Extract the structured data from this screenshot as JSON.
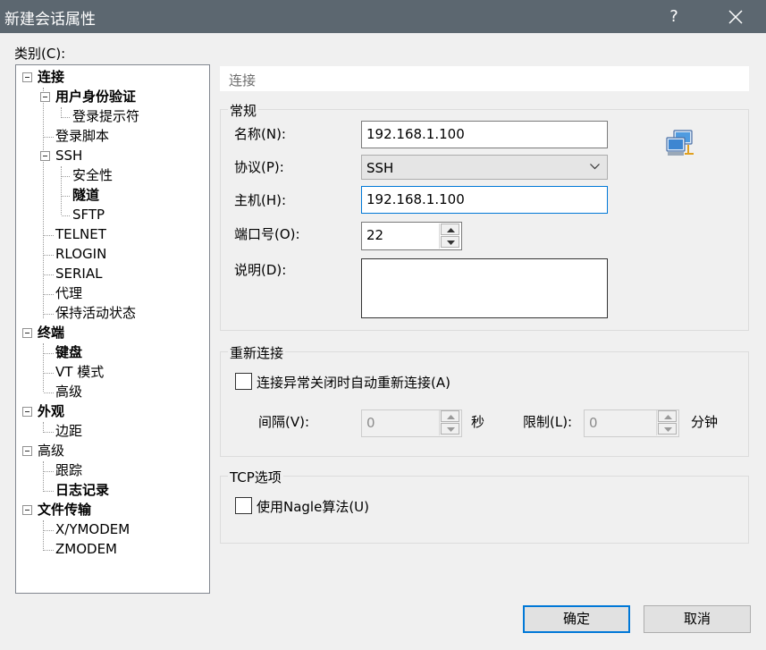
{
  "window": {
    "title": "新建会话属性",
    "help": "?"
  },
  "category_label": "类别(C):",
  "tree": [
    {
      "label": "连接",
      "bold": true,
      "expander": true
    },
    {
      "label": "用户身份验证",
      "bold": true,
      "expander": true
    },
    {
      "label": "登录提示符",
      "bold": false
    },
    {
      "label": "登录脚本",
      "bold": false
    },
    {
      "label": "SSH",
      "bold": false,
      "expander": true
    },
    {
      "label": "安全性",
      "bold": false
    },
    {
      "label": "隧道",
      "bold": true
    },
    {
      "label": "SFTP",
      "bold": false
    },
    {
      "label": "TELNET",
      "bold": false
    },
    {
      "label": "RLOGIN",
      "bold": false
    },
    {
      "label": "SERIAL",
      "bold": false
    },
    {
      "label": "代理",
      "bold": false
    },
    {
      "label": "保持活动状态",
      "bold": false
    },
    {
      "label": "终端",
      "bold": true,
      "expander": true
    },
    {
      "label": "键盘",
      "bold": true
    },
    {
      "label": "VT 模式",
      "bold": false
    },
    {
      "label": "高级",
      "bold": false
    },
    {
      "label": "外观",
      "bold": true,
      "expander": true
    },
    {
      "label": "边距",
      "bold": false
    },
    {
      "label": "高级",
      "bold": false,
      "expander": true
    },
    {
      "label": "跟踪",
      "bold": false
    },
    {
      "label": "日志记录",
      "bold": true
    },
    {
      "label": "文件传输",
      "bold": true,
      "expander": true
    },
    {
      "label": "X/YMODEM",
      "bold": false
    },
    {
      "label": "ZMODEM",
      "bold": false
    }
  ],
  "panel": {
    "header": "连接",
    "general": {
      "title": "常规",
      "name_label": "名称(N):",
      "name_value": "192.168.1.100",
      "protocol_label": "协议(P):",
      "protocol_value": "SSH",
      "host_label": "主机(H):",
      "host_value": "192.168.1.100",
      "port_label": "端口号(O):",
      "port_value": "22",
      "desc_label": "说明(D):",
      "desc_value": ""
    },
    "reconnect": {
      "title": "重新连接",
      "checkbox_label": "连接异常关闭时自动重新连接(A)",
      "checked": false,
      "interval_label": "间隔(V):",
      "interval_value": "0",
      "interval_unit": "秒",
      "limit_label": "限制(L):",
      "limit_value": "0",
      "limit_unit": "分钟"
    },
    "tcp": {
      "title": "TCP选项",
      "nagle_label": "使用Nagle算法(U)",
      "checked": false
    }
  },
  "buttons": {
    "ok": "确定",
    "cancel": "取消"
  },
  "icons": {
    "connection": "network-computers-icon"
  }
}
